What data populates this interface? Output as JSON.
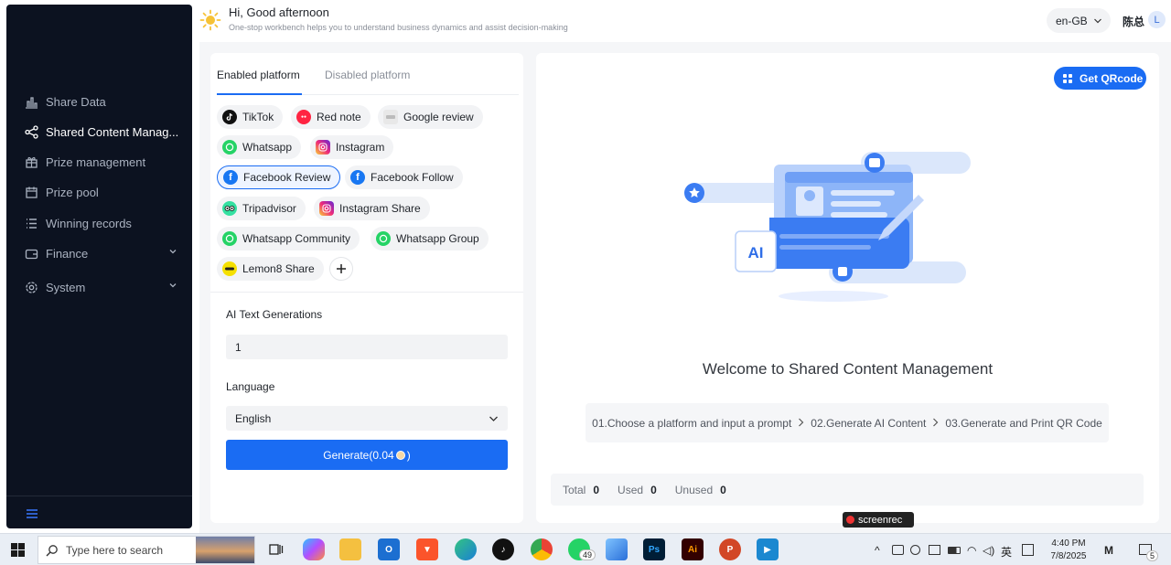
{
  "sidebar": {
    "items": [
      {
        "label": "Share Data",
        "icon": "bar-chart-icon"
      },
      {
        "label": "Shared Content Manag...",
        "icon": "share-icon"
      },
      {
        "label": "Prize management",
        "icon": "gift-icon"
      },
      {
        "label": "Prize pool",
        "icon": "calendar-icon"
      },
      {
        "label": "Winning records",
        "icon": "list-icon"
      },
      {
        "label": "Finance",
        "icon": "wallet-icon"
      },
      {
        "label": "System",
        "icon": "gear-icon"
      }
    ]
  },
  "header": {
    "greeting": "Hi, Good afternoon",
    "subtitle": "One-stop workbench helps you to understand business dynamics and assist decision-making",
    "language": "en-GB",
    "user_name": "陈总",
    "avatar_letter": "L"
  },
  "platform_panel": {
    "tabs": [
      "Enabled platform",
      "Disabled platform"
    ],
    "platforms": [
      {
        "label": "TikTok",
        "color": "#111111"
      },
      {
        "label": "Red note",
        "color": "#ff2442"
      },
      {
        "label": "Google review",
        "color": "#dcdcdc"
      },
      {
        "label": "Whatsapp",
        "color": "#25d366"
      },
      {
        "label": "Instagram",
        "color": "#d62976"
      },
      {
        "label": "Facebook Review",
        "color": "#1877f2"
      },
      {
        "label": "Facebook Follow",
        "color": "#1877f2"
      },
      {
        "label": "Tripadvisor",
        "color": "#34e0a1"
      },
      {
        "label": "Instagram Share",
        "color": "#d62976"
      },
      {
        "label": "Whatsapp Community",
        "color": "#25d366"
      },
      {
        "label": "Whatsapp Group",
        "color": "#25d366"
      },
      {
        "label": "Lemon8 Share",
        "color": "#f5e000"
      }
    ],
    "ai_label": "AI Text Generations",
    "ai_value": "1",
    "language_label": "Language",
    "language_value": "English",
    "generate_prefix": "Generate(0.04",
    "generate_suffix": ")"
  },
  "content_panel": {
    "qr_button": "Get QRcode",
    "welcome": "Welcome to Shared Content Management",
    "steps": [
      "01.Choose a platform and input a prompt",
      "02.Generate AI Content",
      "03.Generate and Print QR Code"
    ],
    "stats": [
      {
        "label": "Total",
        "value": "0"
      },
      {
        "label": "Used",
        "value": "0"
      },
      {
        "label": "Unused",
        "value": "0"
      }
    ],
    "illustration_text": "AI"
  },
  "overlay": {
    "screenrec": "screenrec"
  },
  "taskbar": {
    "search_placeholder": "Type here to search",
    "whatsapp_badge": "49",
    "ime": "英",
    "time": "4:40 PM",
    "date": "7/8/2025",
    "notifications": "5"
  },
  "colors": {
    "accent": "#1a6cf3",
    "sidebar_bg": "#0c1220"
  }
}
